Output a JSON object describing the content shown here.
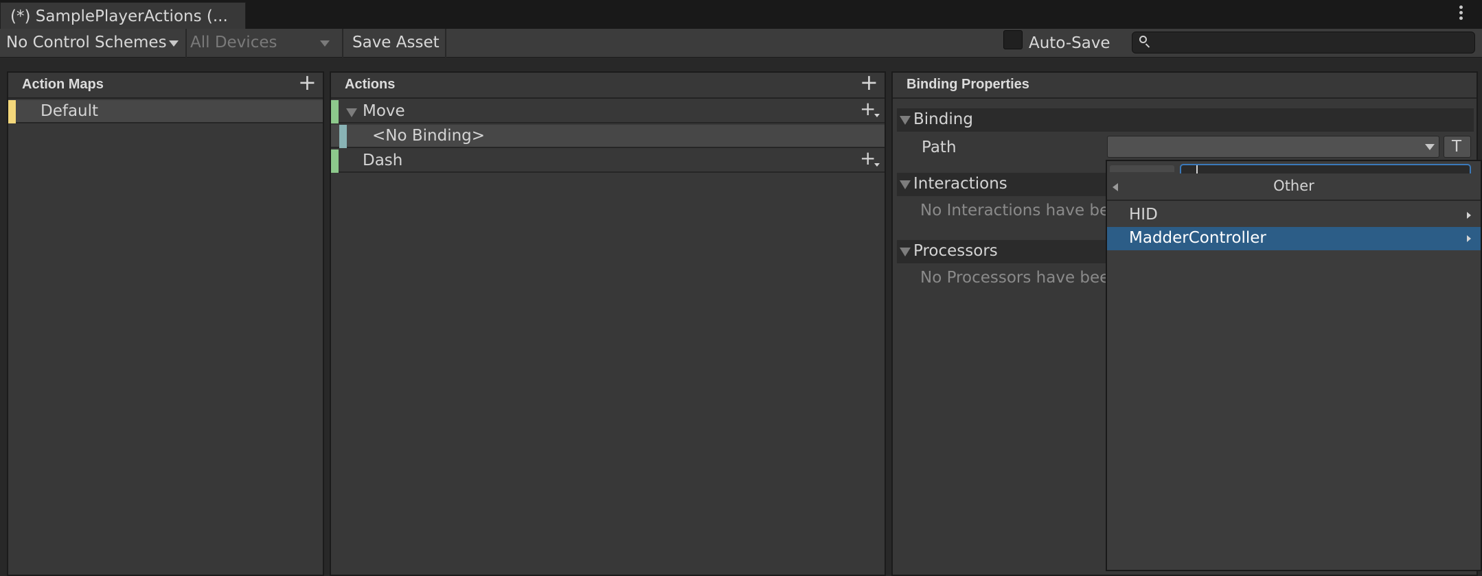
{
  "window": {
    "tab_title": "(*) SamplePlayerActions (..."
  },
  "toolbar": {
    "control_schemes": "No Control Schemes",
    "devices": "All Devices",
    "save_asset": "Save Asset",
    "auto_save": "Auto-Save",
    "auto_save_checked": false,
    "search_value": "",
    "search_placeholder": ""
  },
  "action_maps": {
    "title": "Action Maps",
    "items": [
      {
        "label": "Default",
        "selected": true,
        "color": "#f3d77b"
      }
    ]
  },
  "actions": {
    "title": "Actions",
    "items": [
      {
        "label": "Move",
        "type": "action",
        "expanded": true,
        "color": "#8dc98c"
      },
      {
        "label": "<No Binding>",
        "type": "binding",
        "selected": true,
        "color": "#89b3b5"
      },
      {
        "label": "Dash",
        "type": "action",
        "expanded": false,
        "color": "#8dc98c"
      }
    ]
  },
  "binding_properties": {
    "title": "Binding Properties",
    "binding_section": "Binding",
    "path_label": "Path",
    "path_value": "",
    "path_t_button": "T",
    "interactions_section": "Interactions",
    "interactions_empty": "No Interactions have bee",
    "processors_section": "Processors",
    "processors_empty": "No Processors have bee"
  },
  "popup": {
    "header": "Other",
    "items": [
      {
        "label": "HID",
        "has_submenu": true,
        "selected": false
      },
      {
        "label": "MadderController",
        "has_submenu": true,
        "selected": true
      }
    ]
  },
  "colors": {
    "background": "#282828",
    "panel": "#383838",
    "selection": "#2c5d87",
    "row_selected": "#474747",
    "accent_input_border": "#3a79bb"
  },
  "icons": {
    "kebab": "more-vertical-icon",
    "search": "search-icon",
    "add": "plus-icon",
    "add_dropdown": "plus-dropdown-icon",
    "foldout": "foldout-triangle-icon",
    "dropdown": "chevron-down-icon",
    "back": "chevron-left-icon",
    "submenu": "chevron-right-icon"
  }
}
